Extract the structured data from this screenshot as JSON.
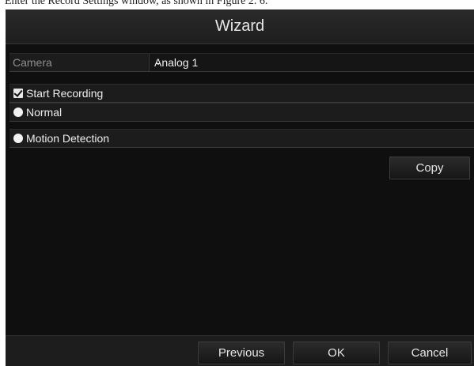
{
  "caption": "Enter the Record Settings window, as shown in Figure 2. 6.",
  "window": {
    "title": "Wizard"
  },
  "camera": {
    "label": "Camera",
    "value": "Analog 1"
  },
  "options": {
    "start_recording": "Start Recording",
    "normal": "Normal",
    "motion_detection": "Motion Detection"
  },
  "buttons": {
    "copy": "Copy",
    "previous": "Previous",
    "ok": "OK",
    "cancel": "Cancel"
  }
}
